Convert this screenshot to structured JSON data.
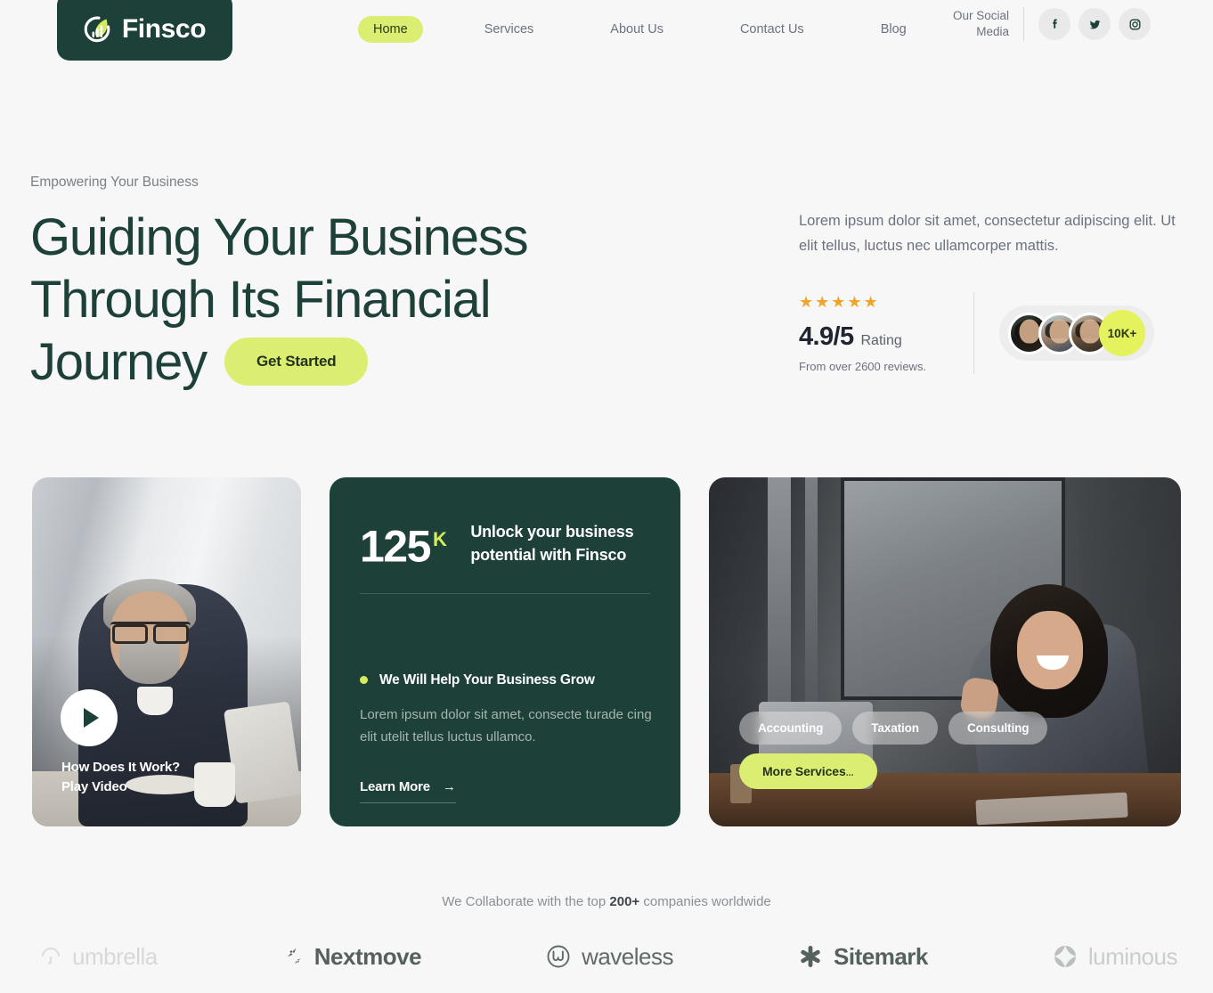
{
  "brand": {
    "name": "Finsco",
    "logo_icon": "finsco-leaf-chart-logo",
    "dark_green": "#1d4038",
    "lime": "#dcee72",
    "page_bg": "#f7f7f7",
    "star_color": "#f0a42c"
  },
  "nav": {
    "items": [
      {
        "label": "Home",
        "active": true
      },
      {
        "label": "Services",
        "active": false
      },
      {
        "label": "About Us",
        "active": false
      },
      {
        "label": "Contact Us",
        "active": false
      },
      {
        "label": "Blog",
        "active": false
      }
    ]
  },
  "social": {
    "label_line1": "Our Social",
    "label_line2": "Media",
    "icons": [
      {
        "name": "facebook-icon"
      },
      {
        "name": "twitter-icon"
      },
      {
        "name": "instagram-icon"
      }
    ]
  },
  "hero": {
    "eyebrow": "Empowering Your Business",
    "title_line1": "Guiding Your Business",
    "title_line2": "Through Its Financial",
    "title_line3": "Journey",
    "cta_label": "Get Started",
    "description": "Lorem ipsum dolor sit amet, consectetur adipiscing elit. Ut elit tellus, luctus nec ullamcorper mattis.",
    "stars": "★★★★★",
    "rating_value": "4.9/5",
    "rating_label": "Rating",
    "rating_sub": "From over 2600 reviews.",
    "avatar_count": "10K+"
  },
  "cards": {
    "video": {
      "play_icon": "play-icon",
      "caption_line1": "How Does It Work?",
      "caption_line2": "Play Video"
    },
    "stat": {
      "number": "125",
      "number_suffix": "K",
      "heading_line1": "Unlock your business",
      "heading_line2": "potential with Finsco",
      "bullet": "We Will Help Your Business Grow",
      "paragraph": "Lorem ipsum dolor sit amet, consecte turade cing elit utelit tellus luctus ullamco.",
      "link_label": "Learn More",
      "link_arrow": "→"
    },
    "office": {
      "pills": [
        "Accounting",
        "Taxation",
        "Consulting"
      ],
      "more_label": "More Services",
      "more_dots": "..."
    }
  },
  "partners": {
    "note_prefix": "We Collaborate with the top ",
    "note_highlight": "200+",
    "note_suffix": " companies worldwide",
    "logos": [
      {
        "name": "umbrella",
        "icon": "umbrella-icon"
      },
      {
        "name": "Nextmove",
        "icon": "nextmove-arrows-icon"
      },
      {
        "name": "waveless",
        "icon": "waveless-w-circle-icon"
      },
      {
        "name": "Sitemark",
        "icon": "sitemark-asterisk-icon"
      },
      {
        "name": "luminous",
        "icon": "luminous-star-icon"
      }
    ]
  }
}
